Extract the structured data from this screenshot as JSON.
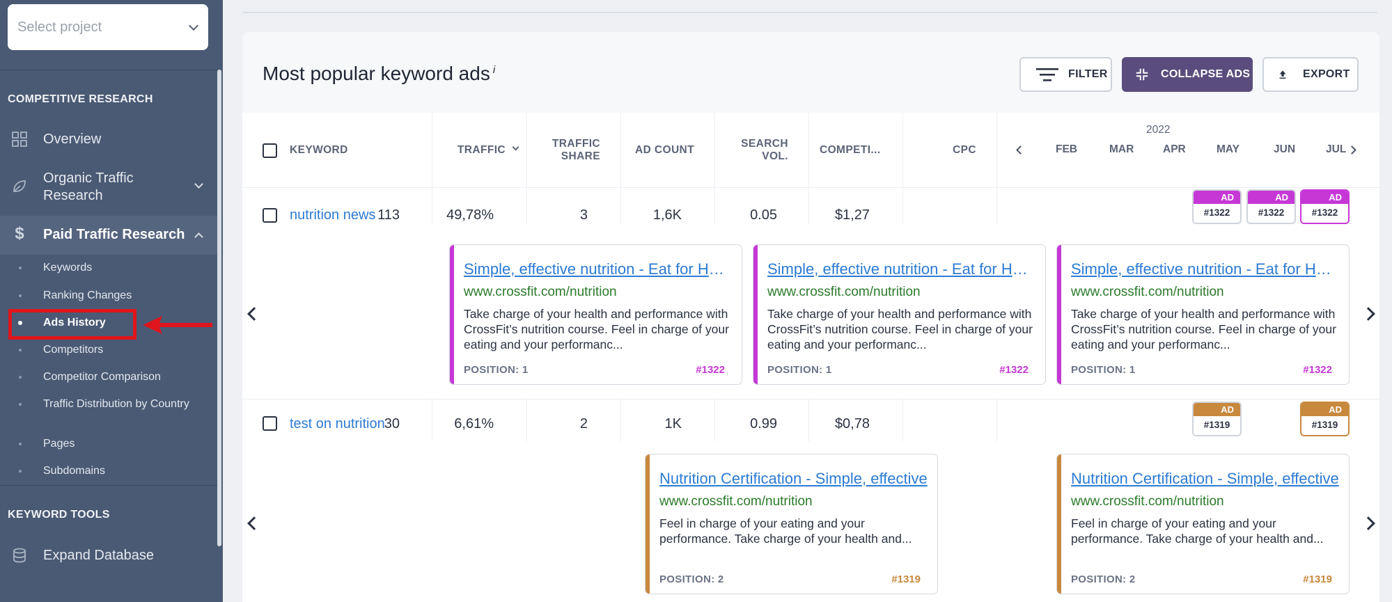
{
  "sidebar": {
    "project_placeholder": "Select project",
    "section_competitive": "COMPETITIVE RESEARCH",
    "overview": "Overview",
    "organic": "Organic Traffic Research",
    "paid": "Paid Traffic Research",
    "sub_items": [
      "Keywords",
      "Ranking Changes",
      "Ads History",
      "Competitors",
      "Competitor Comparison",
      "Traffic Distribution by Country",
      "Pages",
      "Subdomains"
    ],
    "section_keyword_tools": "KEYWORD TOOLS",
    "expand_database": "Expand Database"
  },
  "main": {
    "title": "Most popular keyword ads",
    "title_info": "i",
    "filter_label": "FILTER",
    "collapse_label": "COLLAPSE ADS",
    "export_label": "EXPORT"
  },
  "table": {
    "headers": {
      "keyword": "KEYWORD",
      "traffic": "TRAFFIC",
      "traffic_share_1": "TRAFFIC",
      "traffic_share_2": "SHARE",
      "ad_count": "AD COUNT",
      "search_vol_1": "SEARCH",
      "search_vol_2": "VOL.",
      "competition": "COMPETI...",
      "cpc": "CPC",
      "year": "2022",
      "months": [
        "FEB",
        "MAR",
        "APR",
        "MAY",
        "JUN",
        "JUL"
      ]
    },
    "rows": [
      {
        "keyword": "nutrition news",
        "traffic": "113",
        "traffic_share": "49,78%",
        "ad_count": "3",
        "search_vol": "1,6K",
        "competition": "0.05",
        "cpc": "$1,27",
        "badge_label": "AD",
        "badge_id": "#1322",
        "ads": [
          {
            "title": "Simple, effective nutrition - Eat for Health",
            "url": "www.crossfit.com/nutrition",
            "desc": "Take charge of your health and performance with CrossFit’s nutrition course. Feel in charge of your eating and your performanc...",
            "position": "POSITION: 1",
            "id": "#1322"
          },
          {
            "title": "Simple, effective nutrition - Eat for Health",
            "url": "www.crossfit.com/nutrition",
            "desc": "Take charge of your health and performance with CrossFit’s nutrition course. Feel in charge of your eating and your performanc...",
            "position": "POSITION: 1",
            "id": "#1322"
          },
          {
            "title": "Simple, effective nutrition - Eat for Health",
            "url": "www.crossfit.com/nutrition",
            "desc": "Take charge of your health and performance with CrossFit’s nutrition course. Feel in charge of your eating and your performanc...",
            "position": "POSITION: 1",
            "id": "#1322"
          }
        ]
      },
      {
        "keyword": "test on nutrition",
        "traffic": "30",
        "traffic_share": "6,61%",
        "ad_count": "2",
        "search_vol": "1K",
        "competition": "0.99",
        "cpc": "$0,78",
        "badge_label": "AD",
        "badge_id": "#1319",
        "ads": [
          {
            "title": "Nutrition Certification - Simple, effective",
            "url": "www.crossfit.com/nutrition",
            "desc": "Feel in charge of your eating and your performance. Take charge of your health and...",
            "position": "POSITION: 2",
            "id": "#1319"
          },
          {
            "title": "Nutrition Certification - Simple, effective",
            "url": "www.crossfit.com/nutrition",
            "desc": "Feel in charge of your eating and your performance. Take charge of your health and...",
            "position": "POSITION: 2",
            "id": "#1319"
          }
        ]
      }
    ]
  },
  "colors": {
    "sidebar": "#4a5a74",
    "accent_purple": "#c638d6",
    "accent_gold": "#c8883d",
    "button_dark": "#5a4d7d",
    "link": "#2c7bd3",
    "url_green": "#2b7a2b",
    "highlight_red": "#e0141c"
  }
}
